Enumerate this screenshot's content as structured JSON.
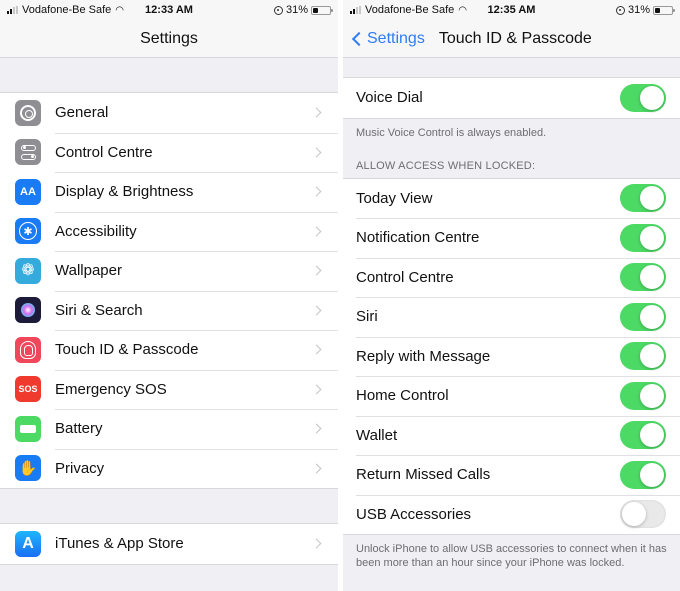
{
  "left": {
    "status_bar": {
      "carrier": "Vodafone-Be Safe",
      "time": "12:33 AM",
      "battery_percent": "31%",
      "battery_level": 0.31
    },
    "nav": {
      "title": "Settings"
    },
    "groups": [
      {
        "items": [
          {
            "label": "General",
            "icon": "gear-icon",
            "color": "#8e8e93"
          },
          {
            "label": "Control Centre",
            "icon": "control-centre-icon",
            "color": "#8e8e93"
          },
          {
            "label": "Display & Brightness",
            "icon": "display-brightness-icon",
            "color": "#1a7cf5",
            "glyph": "AA"
          },
          {
            "label": "Accessibility",
            "icon": "accessibility-icon",
            "color": "#1a7cf5",
            "glyph": "✱"
          },
          {
            "label": "Wallpaper",
            "icon": "wallpaper-icon",
            "color": "#35aadc",
            "glyph": "❁"
          },
          {
            "label": "Siri & Search",
            "icon": "siri-icon",
            "color": "#1c1c3a"
          },
          {
            "label": "Touch ID & Passcode",
            "icon": "fingerprint-icon",
            "color": "#f0475a"
          },
          {
            "label": "Emergency SOS",
            "icon": "sos-icon",
            "color": "#f03a2e",
            "glyph": "SOS"
          },
          {
            "label": "Battery",
            "icon": "battery-icon",
            "color": "#4cd964"
          },
          {
            "label": "Privacy",
            "icon": "hand-icon",
            "color": "#1a7cf5",
            "glyph": "✋"
          }
        ]
      },
      {
        "items": [
          {
            "label": "iTunes & App Store",
            "icon": "app-store-icon",
            "color": "#1d8ef5",
            "glyph": "A"
          }
        ]
      }
    ]
  },
  "right": {
    "status_bar": {
      "carrier": "Vodafone-Be Safe",
      "time": "12:35 AM",
      "battery_percent": "31%",
      "battery_level": 0.31
    },
    "nav": {
      "back_label": "Settings",
      "title": "Touch ID & Passcode"
    },
    "voice_dial": {
      "label": "Voice Dial",
      "on": true
    },
    "voice_footnote": "Music Voice Control is always enabled.",
    "locked_header": "ALLOW ACCESS WHEN LOCKED:",
    "locked_items": [
      {
        "label": "Today View",
        "on": true
      },
      {
        "label": "Notification Centre",
        "on": true
      },
      {
        "label": "Control Centre",
        "on": true
      },
      {
        "label": "Siri",
        "on": true
      },
      {
        "label": "Reply with Message",
        "on": true
      },
      {
        "label": "Home Control",
        "on": true
      },
      {
        "label": "Wallet",
        "on": true
      },
      {
        "label": "Return Missed Calls",
        "on": true
      },
      {
        "label": "USB Accessories",
        "on": false
      }
    ],
    "usb_footnote": "Unlock iPhone to allow USB accessories to connect when it has been more than an hour since your iPhone was locked."
  },
  "colors": {
    "accent": "#2f7cf6",
    "toggle_on": "#4cd964",
    "toggle_off": "#e9e9ea",
    "background": "#efeff4"
  }
}
